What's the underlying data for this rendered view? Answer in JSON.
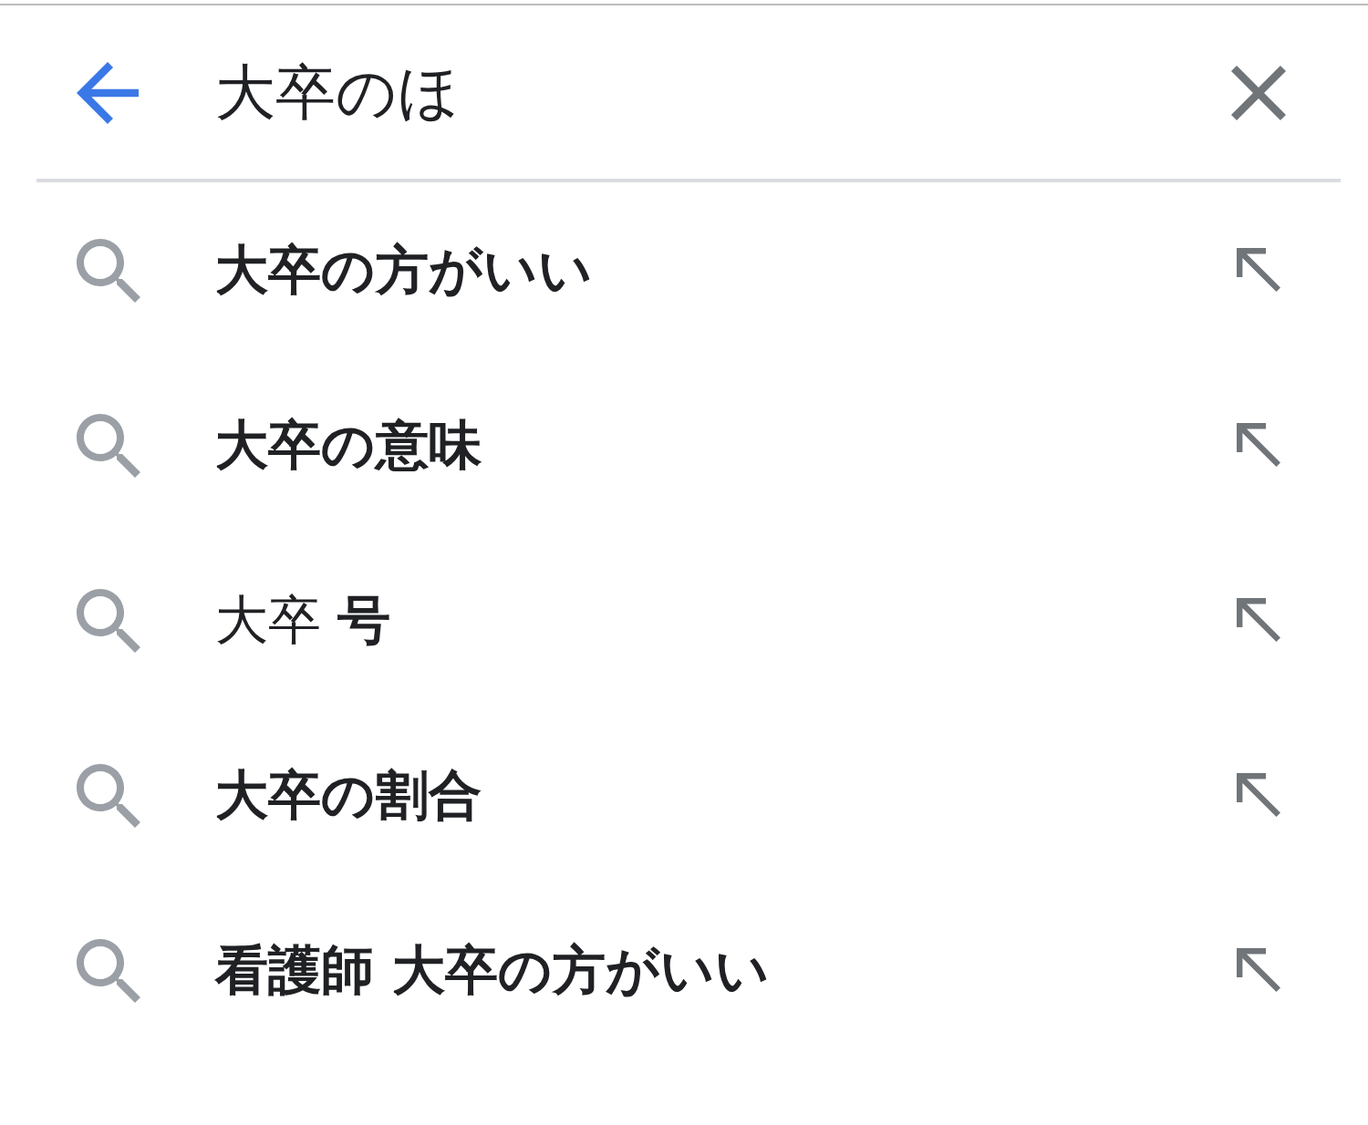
{
  "search_bar": {
    "query": "大卒のほ"
  },
  "suggestions": [
    {
      "kind": "completion",
      "text": "大卒の方がいい"
    },
    {
      "kind": "completion",
      "text": "大卒の意味"
    },
    {
      "kind": "partial",
      "text": "大卒 **号**"
    },
    {
      "kind": "completion",
      "text": "大卒の割合"
    },
    {
      "kind": "completion",
      "text": "看護師 大卒の方がいい"
    }
  ]
}
